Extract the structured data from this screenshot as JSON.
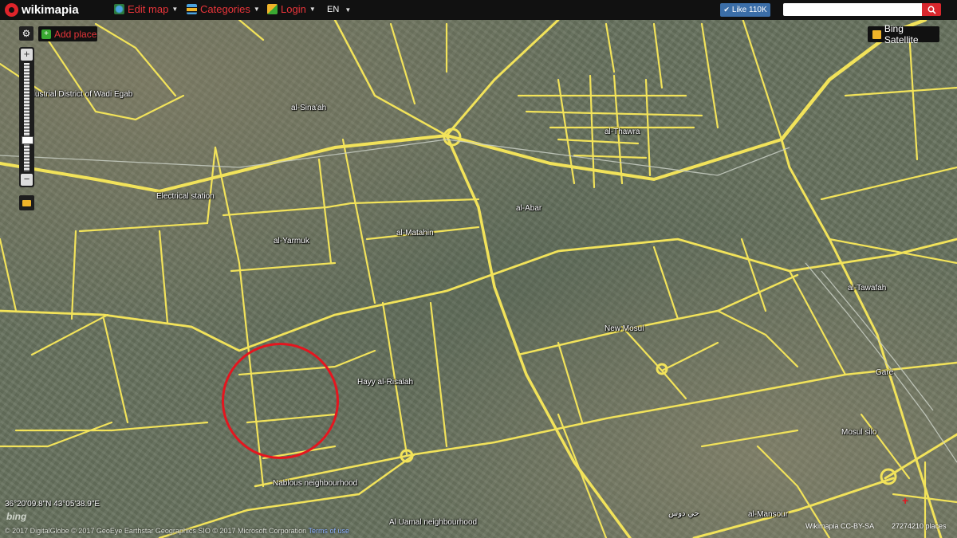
{
  "header": {
    "brand": "wikimapia",
    "menu": {
      "edit_map": "Edit map",
      "categories": "Categories",
      "login": "Login",
      "language": "EN"
    },
    "like_label": "Like 110K",
    "search": {
      "value": "",
      "placeholder": ""
    }
  },
  "controls": {
    "add_place": "Add place",
    "layer_button": "Bing Satellite"
  },
  "map": {
    "labels": [
      "Industrial District of Wadi Egab",
      "al-Sina'ah",
      "al-Thawra",
      "Electrical station",
      "al-Yarmuk",
      "al-Matahin",
      "al-Abar",
      "al-Tawafah",
      "New Mosul",
      "Hayy al-Risalah",
      "Gare",
      "Mosul silo",
      "Nablous neighbourhood",
      "al-Mansour",
      "Al Uamal neighbourhood",
      "حي دوس"
    ]
  },
  "footer": {
    "coordinates": "36°20'09.8\"N 43°05'38.9\"E",
    "copyright": "© 2017 DigitalGlobe © 2017 GeoEye Earthstar Geographics SIO © 2017 Microsoft Corporation",
    "terms_link": "Terms of use",
    "bing": "bing",
    "license": "Wikimapia  CC-BY-SA",
    "places_count": "27274210 places"
  },
  "colors": {
    "accent": "#e4161f",
    "road": "#f2e35a",
    "topbar": "#111111"
  }
}
